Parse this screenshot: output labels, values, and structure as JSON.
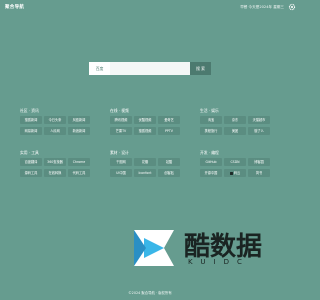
{
  "header": {
    "logo": "聚合导航",
    "time_text": "早餐 今天是2024年 星期三",
    "settings_icon": "gear-icon"
  },
  "search": {
    "tag": "百度",
    "placeholder": "",
    "button_label": "搜 索"
  },
  "groups": [
    {
      "title": "社区 · 资讯",
      "items": [
        "搜狐新闻",
        "今日头条",
        "凤凰新闻",
        "网易新闻",
        "人民网",
        "新浪新闻"
      ]
    },
    {
      "title": "在线 · 视频",
      "items": [
        "腾讯视频",
        "优酷视频",
        "爱奇艺",
        "芒果TV",
        "搜狐视频",
        "PPTV"
      ]
    },
    {
      "title": "生活 · 娱乐",
      "items": [
        "淘宝",
        "京东",
        "天猫超市",
        "携程旅行",
        "美团",
        "饿了么"
      ]
    },
    {
      "title": "实用 · 工具",
      "items": [
        "百度翻译",
        "360查找器",
        "Chrome",
        "源码工具",
        "在线转换",
        "代码工具"
      ]
    },
    {
      "title": "素材 · 设计",
      "items": [
        "千图网",
        "花瓣",
        "站酷",
        "UI中国",
        "Iconfont",
        "创客贴"
      ]
    },
    {
      "title": "开发 · 编程",
      "items": [
        "GitHub",
        "CSDN",
        "博客园",
        "开源中国",
        "码云",
        "简书"
      ]
    }
  ],
  "watermark": {
    "text": "酷数据",
    "sub": "KUIDC"
  },
  "footer": {
    "text": "©2024 聚合导航 · 版权所有"
  }
}
